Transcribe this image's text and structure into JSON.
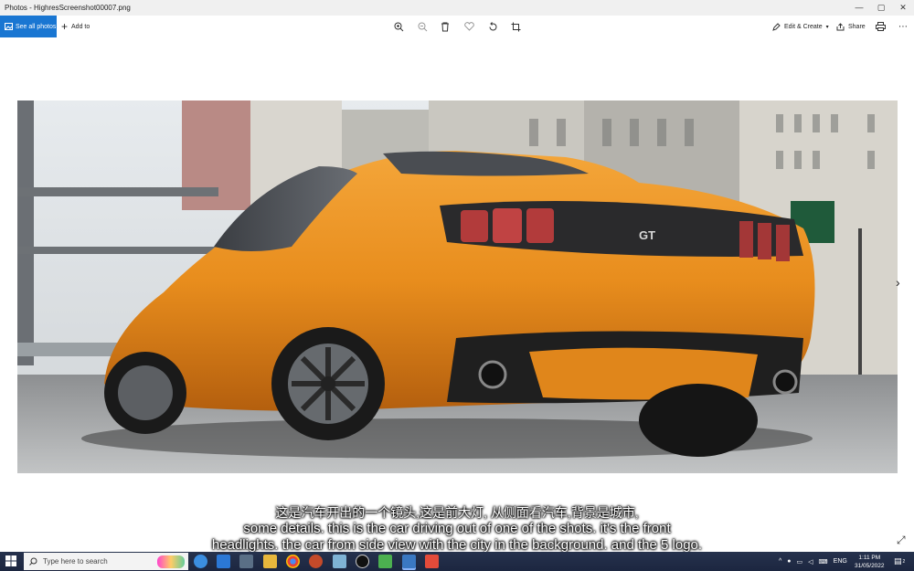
{
  "window": {
    "title": "Photos - HighresScreenshot00007.png",
    "controls": [
      "—",
      "▢",
      "✕"
    ]
  },
  "toolbar": {
    "see_all_label": "See all photos",
    "add_to_label": "Add to",
    "edit_create_label": "Edit & Create",
    "share_label": "Share",
    "icons": [
      "zoom-in-icon",
      "zoom-out-icon",
      "delete-icon",
      "favorite-icon",
      "rotate-icon",
      "crop-icon",
      "print-icon",
      "more-icon"
    ]
  },
  "photo": {
    "plate": "GT"
  },
  "subtitles": {
    "line1": "这是汽车开出的一个镜头,这是前大灯, 从侧面看汽车,背景是城市,",
    "line2": "some details. this is the car driving out of one of the shots. it's the front",
    "line3": "headlights. the car from side view with the city in the background. and the 5 logo."
  },
  "taskbar": {
    "search_placeholder": "Type here to search",
    "lang": "ENG",
    "time": "1:11 PM",
    "date": "31/05/2022",
    "notification_count": "2"
  },
  "colors": {
    "accent": "#1976d2",
    "car": "#e8901f"
  }
}
